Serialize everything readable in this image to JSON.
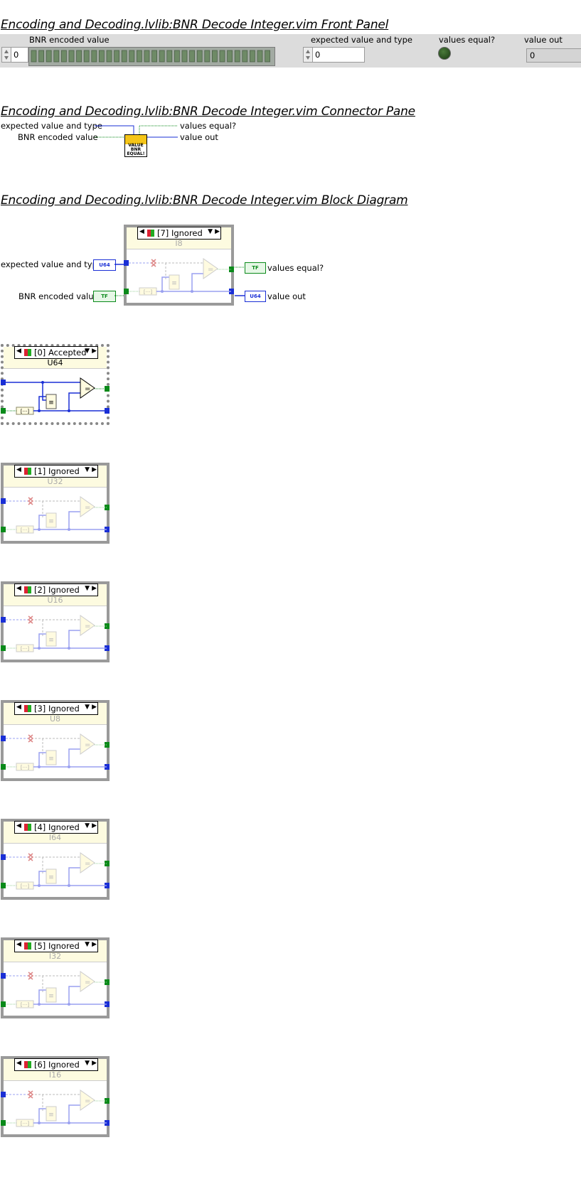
{
  "front_panel": {
    "title": "Encoding and Decoding.lvlib:BNR Decode Integer.vim Front Panel",
    "bnr_label": "BNR encoded value",
    "bnr_index": "0",
    "expected_label": "expected value and type",
    "expected_value": "0",
    "equal_label": "values equal?",
    "out_label": "value out",
    "out_value": "0"
  },
  "connector_pane": {
    "title": "Encoding and Decoding.lvlib:BNR Decode Integer.vim Connector Pane",
    "in_expected": "expected value and type",
    "in_bnr": "BNR encoded value",
    "out_equal": "values equal?",
    "out_value": "value out",
    "icon_lines": [
      "VALUE",
      "BNR",
      "EQUAL!"
    ]
  },
  "block_diagram": {
    "title": "Encoding and Decoding.lvlib:BNR Decode Integer.vim Block Diagram",
    "ctl_expected": "expected value and type",
    "ctl_bnr": "BNR encoded value",
    "ind_equal": "values equal?",
    "ind_out": "value out",
    "term_u64": "U64",
    "term_tf": "TF",
    "cases": [
      {
        "selector": "[7] Ignored",
        "type": "I8",
        "accepted": false
      },
      {
        "selector": "[0] Accepted",
        "type": "U64",
        "accepted": true
      },
      {
        "selector": "[1] Ignored",
        "type": "U32",
        "accepted": false
      },
      {
        "selector": "[2] Ignored",
        "type": "U16",
        "accepted": false
      },
      {
        "selector": "[3] Ignored",
        "type": "U8",
        "accepted": false
      },
      {
        "selector": "[4] Ignored",
        "type": "I64",
        "accepted": false
      },
      {
        "selector": "[5] Ignored",
        "type": "I32",
        "accepted": false
      },
      {
        "selector": "[6] Ignored",
        "type": "I16",
        "accepted": false
      }
    ]
  },
  "colors": {
    "int_wire": "#1a2fd6",
    "bool_wire": "#0a8a1a",
    "case_header": "#fdfbe0",
    "frame_gray": "#9a9a9a"
  }
}
